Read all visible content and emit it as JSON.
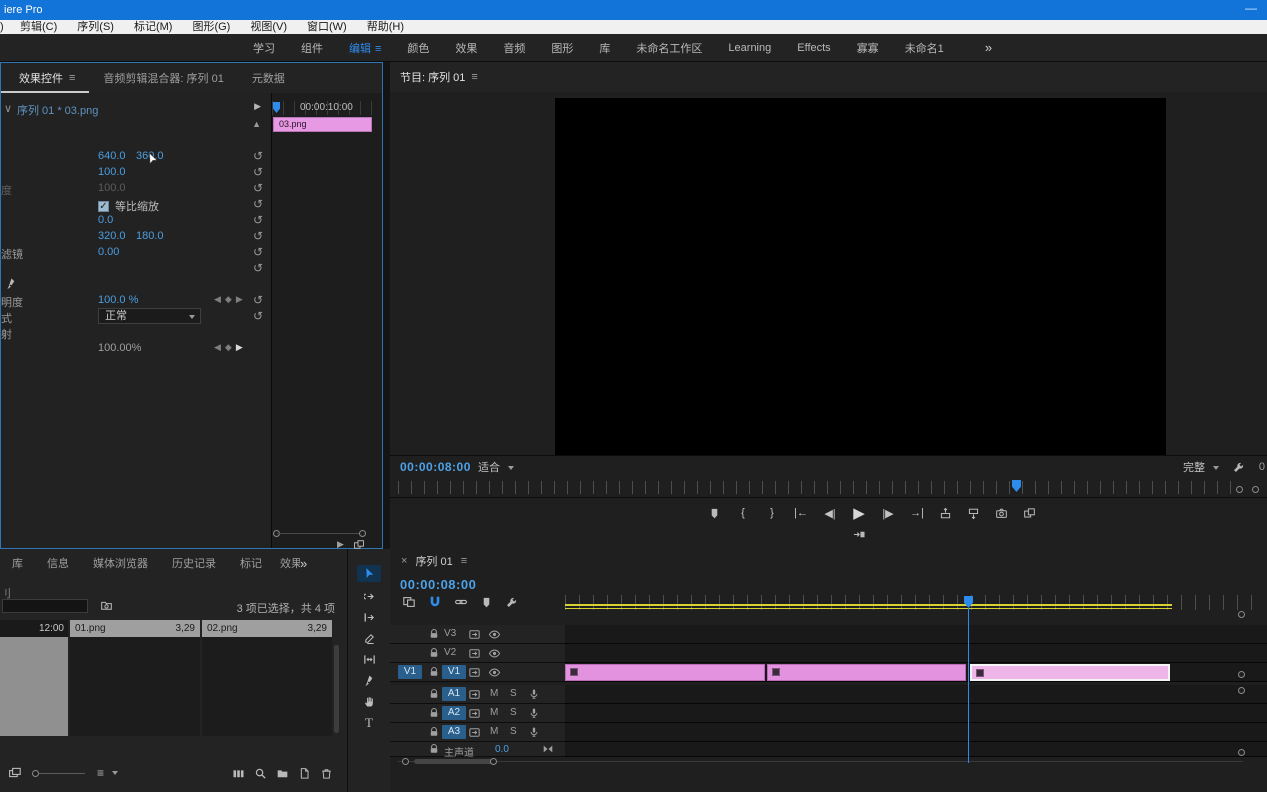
{
  "titlebar": {
    "title": "iere Pro",
    "minimize": "—"
  },
  "menubar": {
    "partial_left": ")",
    "items": [
      "剪辑(C)",
      "序列(S)",
      "标记(M)",
      "图形(G)",
      "视图(V)",
      "窗口(W)",
      "帮助(H)"
    ]
  },
  "workspace": {
    "tabs": [
      "学习",
      "组件",
      "编辑",
      "颜色",
      "效果",
      "音频",
      "图形",
      "库",
      "未命名工作区",
      "Learning",
      "Effects",
      "寡寡",
      "未命名1"
    ],
    "active": "编辑"
  },
  "glyphs": {
    "menu": "≡",
    "overflow": "»",
    "close": "×",
    "collapse": "∨",
    "collapse_up": "▲",
    "play_small": "▶",
    "reset": "↺",
    "kf_prev": "◀",
    "kf_mid": "◆",
    "kf_next": "▶"
  },
  "effect_controls": {
    "tabs": [
      "效果控件",
      "音频剪辑混合器: 序列 01",
      "元数据"
    ],
    "clip_header": "序列 01 * 03.png",
    "mini_timeline": {
      "timecode": "00:00:10:00",
      "clip_label": "03.png"
    },
    "rows": {
      "position": {
        "x": "640.0",
        "y": "360.0"
      },
      "scale": {
        "value": "100.0"
      },
      "scale_width": {
        "label_partial": "度",
        "value": "100.0"
      },
      "uniform_scale": {
        "label": "等比缩放"
      },
      "rotation": {
        "value": "0.0"
      },
      "anchor": {
        "x": "320.0",
        "y": "180.0"
      },
      "antiflicker": {
        "label_partial": "滤镜",
        "value": "0.00"
      },
      "opacity": {
        "label_partial": "明度",
        "value": "100.0 %"
      },
      "blend_mode": {
        "label_partial": "式",
        "value": "正常"
      },
      "time_remap": {
        "label_partial": "射"
      },
      "speed": {
        "value": "100.00%"
      }
    }
  },
  "program_monitor": {
    "tab": "节目: 序列 01",
    "timecode": "00:00:08:00",
    "fit_select": "适合",
    "quality_select": "完整",
    "edge_partial": "0",
    "transport": {
      "mark_in": "{",
      "mark_out": "}",
      "goto_in": "|←",
      "step_back": "◀|",
      "play": "▶",
      "step_fwd": "|▶",
      "goto_out": "→|"
    }
  },
  "project_panel": {
    "tabs": [
      "库",
      "信息",
      "媒体浏览器",
      "历史记录",
      "标记",
      "效果"
    ],
    "partial_label": "刂",
    "selection_status": "3 项已选择，共 4 项",
    "thumb_time": "12:00",
    "items": [
      {
        "name": "01.png",
        "duration": "3,29"
      },
      {
        "name": "02.png",
        "duration": "3,29"
      }
    ]
  },
  "timeline": {
    "tab": "序列 01",
    "timecode": "00:00:08:00",
    "video_tracks": [
      "V3",
      "V2",
      "V1"
    ],
    "audio_tracks": [
      "A1",
      "A2",
      "A3"
    ],
    "audio_buttons": {
      "mute": "M",
      "solo": "S"
    },
    "master": {
      "label": "主声道",
      "value": "0.0"
    },
    "source_patch": "V1"
  },
  "colors": {
    "accent_blue": "#2d8ceb",
    "titlebar_blue": "#1273d8",
    "value_blue": "#4c9ee0",
    "clip_pink": "#e292de",
    "clip_selected": "#eeb5e9",
    "workarea_yellow": "#d6d232"
  }
}
